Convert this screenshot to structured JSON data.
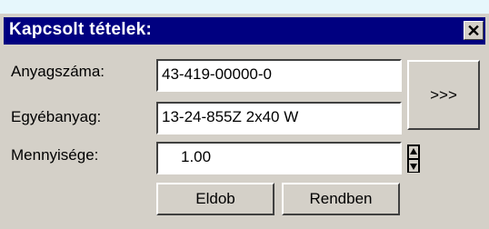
{
  "window": {
    "title": "Kapcsolt tételek:",
    "close_glyph": "✕"
  },
  "fields": {
    "material_number": {
      "label": "Anyagszáma:",
      "value": "43-419-00000-0"
    },
    "other_material": {
      "label": "Egyébanyag:",
      "value": "13-24-855Z 2x40 W"
    },
    "quantity": {
      "label": "Mennyisége:",
      "value": "1.00"
    }
  },
  "buttons": {
    "more": ">>>",
    "discard": "Eldob",
    "ok": "Rendben"
  },
  "icons": {
    "close": "close-icon",
    "spin_up": "arrow-up-icon",
    "spin_down": "arrow-down-icon"
  },
  "colors": {
    "titlebar": "#000080",
    "dialog": "#d4d0c8",
    "background": "#e6f7fc"
  }
}
